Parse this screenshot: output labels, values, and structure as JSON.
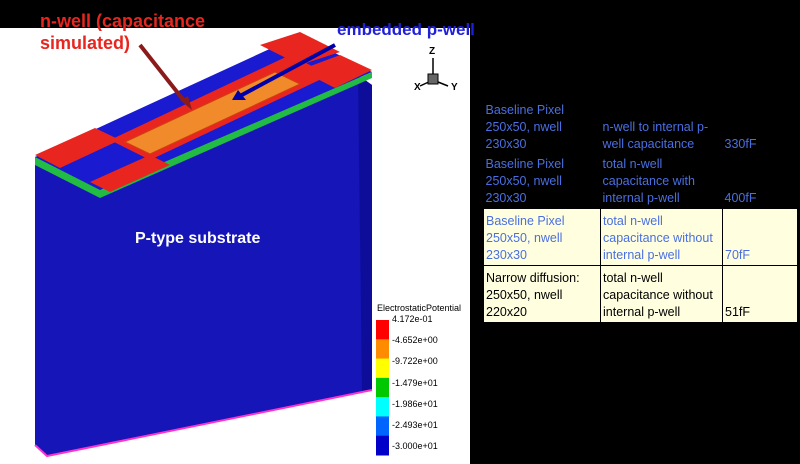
{
  "annotations": {
    "nwell_label_line1": "n-well (capacitance",
    "nwell_label_line2": "simulated)",
    "pwell_label": "embedded p-well",
    "substrate_label": "P-type substrate"
  },
  "axes": {
    "z": "Z",
    "x": "X",
    "y": "Y"
  },
  "legend": {
    "title": "ElectrostaticPotential",
    "ticks": [
      "4.172e-01",
      "-4.652e+00",
      "-9.722e+00",
      "-1.479e+01",
      "-1.986e+01",
      "-2.493e+01",
      "-3.000e+01"
    ],
    "colors": [
      "#ff0000",
      "#ff8c00",
      "#ffff00",
      "#00c800",
      "#00ffff",
      "#0064ff",
      "#0000c8"
    ]
  },
  "colors": {
    "nwell": "#e8261f",
    "pwell": "#1f1fd8",
    "substrate": "#1515b8",
    "table_blue_text": "#4a6fe0",
    "table_light_bg": "#ffffe0"
  },
  "table": [
    {
      "c1": [
        "Baseline Pixel",
        "250x50, nwell",
        "230x30"
      ],
      "c2": [
        "n-well to internal p-",
        "well capacitance"
      ],
      "c3": "330fF",
      "style": "dark"
    },
    {
      "c1": [
        "Baseline Pixel",
        "250x50, nwell",
        "230x30"
      ],
      "c2": [
        "total n-well",
        "capacitance with",
        "internal p-well"
      ],
      "c3": "400fF",
      "style": "dark"
    },
    {
      "c1": [
        "Baseline Pixel",
        "250x50, nwell",
        "230x30"
      ],
      "c2": [
        "total n-well",
        "capacitance without",
        "internal p-well"
      ],
      "c3": "70fF",
      "style": "light"
    },
    {
      "c1": [
        "Narrow diffusion:",
        "250x50, nwell",
        "220x20"
      ],
      "c2": [
        "total n-well",
        "capacitance without",
        "internal p-well"
      ],
      "c3": "51fF",
      "style": "light2"
    }
  ]
}
